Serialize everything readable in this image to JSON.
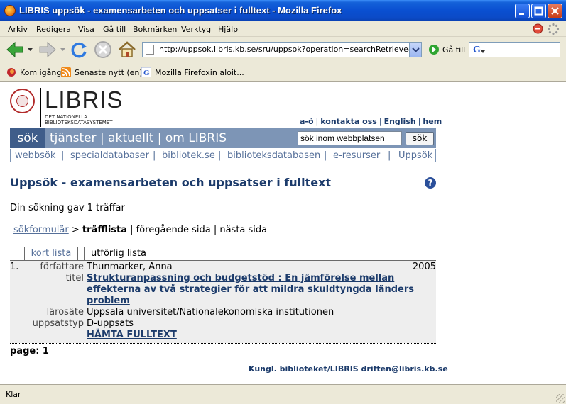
{
  "window": {
    "title": "LIBRIS uppsök - examensarbeten och uppsatser i fulltext - Mozilla Firefox"
  },
  "menu": [
    "Arkiv",
    "Redigera",
    "Visa",
    "Gå till",
    "Bokmärken",
    "Verktyg",
    "Hjälp"
  ],
  "toolbar": {
    "url": "http://uppsok.libris.kb.se/sru/uppsok?operation=searchRetrieve&query=",
    "go_label": "Gå till"
  },
  "bookmarks": [
    "Kom igång",
    "Senaste nytt (en)",
    "Mozilla Firefoxin aloit..."
  ],
  "site": {
    "logo": "LIBRIS",
    "logo_sub_1": "DET NATIONELLA",
    "logo_sub_2": "BIBLIOTEKSDATASYSTEMET",
    "toplinks": [
      "a-ö",
      "kontakta oss",
      "English",
      "hem"
    ],
    "nav_active": "sök",
    "nav_links": "tjänster | aktuellt | om LIBRIS",
    "search_placeholder": "sök inom webbplatsen",
    "search_button": "sök",
    "subnav": [
      "webbsök",
      "specialdatabaser",
      "bibliotek.se",
      "biblioteksdatabasen",
      "e-resurser",
      "Uppsök"
    ]
  },
  "page": {
    "title": "Uppsök - examensarbeten och uppsatser i fulltext",
    "help": "?",
    "hits": "Din sökning gav 1 träffar",
    "crumb_form": "sökformulär",
    "crumb_arrow": ">",
    "crumb_list": "träfflista",
    "crumb_rest": "| föregående sida | nästa sida",
    "tab_short": "kort lista",
    "tab_full": "utförlig lista"
  },
  "record": {
    "num": "1.",
    "year": "2005",
    "author_label": "författare",
    "author": "Thunmarker, Anna",
    "title_label": "titel",
    "title_1": "Strukturanpassning och budgetstöd : En jämförelse mellan",
    "title_2": "effekterna av två strategier för att mildra skuldtyngda länders",
    "title_3": "problem",
    "inst_label": "lärosäte",
    "inst": "Uppsala universitet/Nationalekonomiska institutionen",
    "type_label": "uppsatstyp",
    "type": "D-uppsats",
    "fulltext": "HÄMTA FULLTEXT"
  },
  "paging": "page: 1",
  "footer": "Kungl. biblioteket/LIBRIS   driften@libris.kb.se",
  "status": "Klar"
}
